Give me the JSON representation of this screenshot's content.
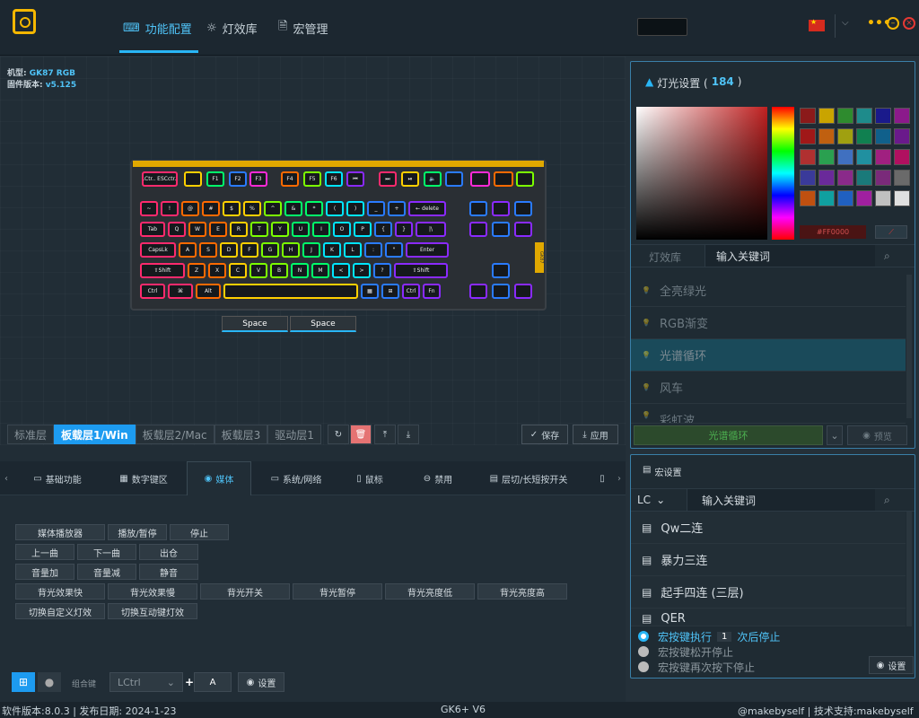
{
  "nav": {
    "tabs": [
      {
        "label": "功能配置",
        "icon": "keyboard-icon",
        "active": true
      },
      {
        "label": "灯效库",
        "icon": "sun-icon",
        "active": false
      },
      {
        "label": "宏管理",
        "icon": "document-icon",
        "active": false
      }
    ]
  },
  "window": {
    "language_flag": "china-flag-icon",
    "accent": "#29b6f6"
  },
  "device": {
    "model_label": "机型:",
    "model_value": "GK87 RGB",
    "firmware_label": "固件版本:",
    "firmware_value": "v5.125"
  },
  "keyboard": {
    "thumb_labels": [
      "LCtr..",
      "ESCctr..",
      "PU",
      "[",
      "]"
    ],
    "rows": [
      [
        "",
        "",
        "F1",
        "F2",
        "F3",
        "F4",
        "F5",
        "F6",
        "⏮",
        "⏭",
        "⏯",
        "🔈",
        "",
        "",
        ""
      ],
      [
        "~",
        "!",
        "@",
        "#",
        "$",
        "%",
        "^",
        "&",
        "*",
        "(",
        ")",
        "_",
        "+",
        "← delete"
      ],
      [
        "Tab",
        "Q",
        "W",
        "E",
        "R",
        "T",
        "Y",
        "U",
        "I",
        "O",
        "P",
        "{",
        "}",
        "|\\"
      ],
      [
        "CapsLk",
        "A",
        "S",
        "D",
        "F",
        "G",
        "H",
        "J",
        "K",
        "L",
        ":",
        "\"",
        "Enter"
      ],
      [
        "⇧Shift",
        "Z",
        "X",
        "C",
        "V",
        "B",
        "N",
        "M",
        "<",
        ">",
        "?",
        "⇧Shift"
      ],
      [
        "Ctrl",
        "⌘",
        "Alt",
        "",
        "▦",
        "⊞",
        "Ctrl",
        "Fn"
      ]
    ],
    "side_label": "GK87",
    "spacebars": [
      "Space",
      "Space"
    ]
  },
  "layers": {
    "items": [
      "标准层",
      "板载层1/Win",
      "板载层2/Mac",
      "板载层3",
      "驱动层1"
    ],
    "active": 1,
    "save_label": "保存",
    "apply_label": "应用"
  },
  "function_tabs": {
    "items": [
      "基础功能",
      "数字键区",
      "媒体",
      "系统/网络",
      "鼠标",
      "禁用",
      "层切/长短按开关"
    ],
    "active": 2
  },
  "media_buttons": [
    [
      "媒体播放器",
      "播放/暂停",
      "停止"
    ],
    [
      "上一曲",
      "下一曲",
      "出仓"
    ],
    [
      "音量加",
      "音量减",
      "静音"
    ],
    [
      "背光效果快",
      "背光效果慢",
      "背光开关",
      "背光暂停",
      "背光亮度低",
      "背光亮度高"
    ],
    [
      "切换自定义灯效",
      "切换互动键灯效"
    ]
  ],
  "combo": {
    "label": "组合键",
    "modifier_value": "LCtrl",
    "plus": "+",
    "key_value": "A",
    "settings_label": "设置"
  },
  "status": {
    "version": "软件版本:8.0.3 | 发布日期: 2024-1-23",
    "device": "GK6+ V6",
    "credit": "@makebyself | 技术支持:makebyself"
  },
  "light_panel": {
    "title": "灯光设置 (",
    "count": "184",
    "title_end": ")",
    "hex_value": "#FF0000",
    "search_tab": "灯效库",
    "search_placeholder": "输入关键词",
    "effects": [
      "全亮绿光",
      "RGB渐变",
      "光谱循环",
      "风车",
      "彩虹波"
    ],
    "active_effect": 2,
    "selected_effect_label": "光谱循环",
    "preview_label": "预览",
    "swatches": [
      "#8b1a1a",
      "#c9a400",
      "#2e8b2e",
      "#1e8b8b",
      "#1a1a8b",
      "#8b1a8b",
      "#a01818",
      "#c06010",
      "#a0a010",
      "#108050",
      "#10608b",
      "#6a1a8b",
      "#b03030",
      "#2aa050",
      "#4070c0",
      "#2090a0",
      "#a02080",
      "#b01060",
      "#3a3a9a",
      "#6a2a9a",
      "#8a2a8a",
      "#1a7a7a",
      "#7a2a7a",
      "#6a6a6a",
      "#c05010",
      "#10a0a0",
      "#2060c0",
      "#a020a0",
      "#c0c0c0",
      "#e0e0e0"
    ]
  },
  "macro_panel": {
    "title": "宏设置",
    "filter_value": "LC",
    "search_placeholder": "输入关键词",
    "items": [
      "Qw二连",
      "暴力三连",
      "起手四连 (三层)",
      "QER"
    ],
    "options": {
      "run_prefix": "宏按键执行",
      "run_count": "1",
      "run_suffix": "次后停止",
      "release_stop": "宏按键松开停止",
      "repress_stop": "宏按键再次按下停止"
    },
    "settings_label": "设置"
  }
}
